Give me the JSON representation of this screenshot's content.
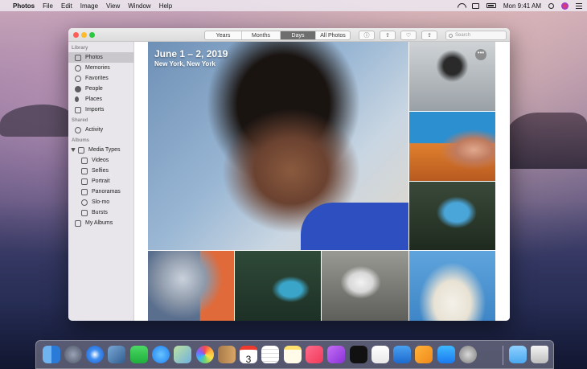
{
  "menubar": {
    "app_name": "Photos",
    "menus": [
      "File",
      "Edit",
      "Image",
      "View",
      "Window",
      "Help"
    ],
    "clock": "Mon 9:41 AM"
  },
  "toolbar": {
    "segments": [
      "Years",
      "Months",
      "Days",
      "All Photos"
    ],
    "active_segment": "Days",
    "search_placeholder": "Search"
  },
  "sidebar": {
    "library_header": "Library",
    "library_items": [
      "Photos",
      "Memories",
      "Favorites",
      "People",
      "Places",
      "Imports"
    ],
    "shared_header": "Shared",
    "shared_items": [
      "Activity"
    ],
    "albums_header": "Albums",
    "media_types_label": "Media Types",
    "media_types": [
      "Videos",
      "Selfies",
      "Portrait",
      "Panoramas",
      "Slo-mo",
      "Bursts"
    ],
    "my_albums_label": "My Albums",
    "selected": "Photos"
  },
  "content": {
    "date_title": "June 1 – 2, 2019",
    "location": "New York, New York",
    "more_button": "•••"
  },
  "dock": {
    "icons": [
      "finder-icon",
      "launchpad-icon",
      "safari-icon",
      "photo-preview-icon",
      "facetime-icon",
      "messages-icon",
      "maps-icon",
      "photos-icon",
      "notes-book-icon",
      "calendar-icon",
      "reminders-icon",
      "notes-icon",
      "music-icon",
      "podcasts-icon",
      "tv-icon",
      "numbers-icon",
      "keynote-icon",
      "pages-icon",
      "app-store-icon",
      "system-preferences-icon",
      "downloads-folder-icon",
      "trash-icon"
    ],
    "calendar_day": "3"
  }
}
